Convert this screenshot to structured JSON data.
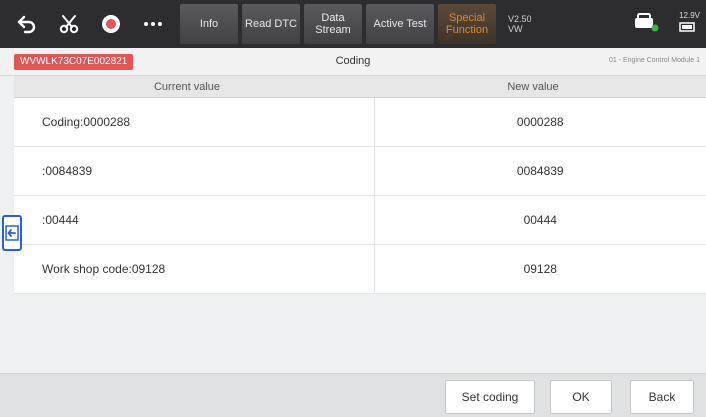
{
  "toolbar": {
    "icons": [
      "back-arrow-icon",
      "scissors-icon",
      "record-icon",
      "more-icon"
    ],
    "tabs": [
      {
        "label": "Info"
      },
      {
        "label": "Read DTC"
      },
      {
        "label": "Data\nStream"
      },
      {
        "label": "Active Test"
      },
      {
        "label": "Special\nFunction",
        "color": "#d98a2e"
      }
    ],
    "version": "V2.50\nVW",
    "battery": "12.9V"
  },
  "info": {
    "vin": "WVWLK73C07E002821",
    "title": "Coding",
    "module": "01 - Engine Control Module 1"
  },
  "table": {
    "headers": [
      "Current value",
      "New value"
    ],
    "rows": [
      {
        "current": "Coding:0000288",
        "new": "0000288"
      },
      {
        "current": ":0084839",
        "new": "0084839"
      },
      {
        "current": ":00444",
        "new": "00444"
      },
      {
        "current": "Work shop code:09128",
        "new": "09128"
      }
    ]
  },
  "footer": {
    "set_coding": "Set coding",
    "ok": "OK",
    "back": "Back"
  },
  "colors": {
    "vin_badge": "#e05555",
    "accent": "#2a63c6",
    "toolbar": "#2d2d30"
  }
}
